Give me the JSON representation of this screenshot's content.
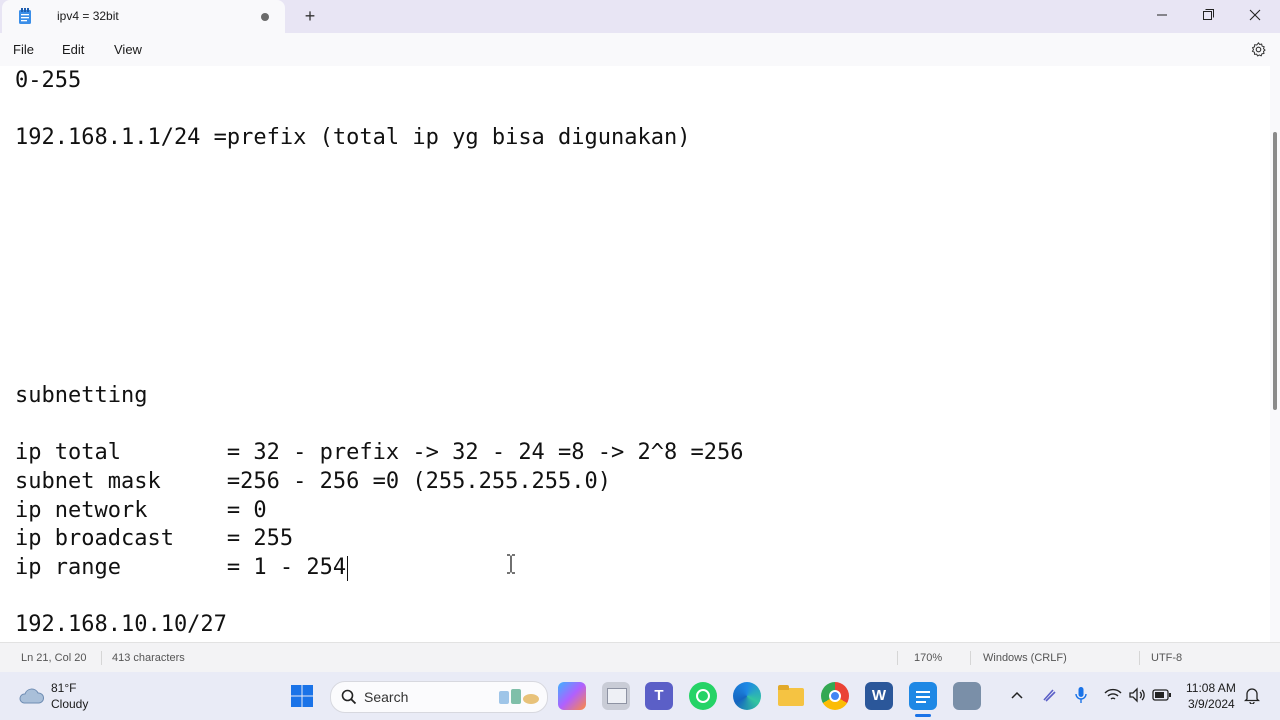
{
  "window": {
    "tab_title": "ipv4 = 32bit",
    "new_tab_symbol": "+"
  },
  "menu": {
    "file": "File",
    "edit": "Edit",
    "view": "View"
  },
  "editor": {
    "lines": [
      "0-255",
      "192.168.1.1/24 =prefix (total ip yg bisa digunakan)",
      "subnetting",
      "ip total        = 32 - prefix -> 32 - 24 =8 -> 2^8 =256",
      "subnet mask     =256 - 256 =0 (255.255.255.0)",
      "ip network      = 0",
      "ip broadcast    = 255",
      "ip range        = 1 - 254",
      "192.168.10.10/27"
    ]
  },
  "status": {
    "position": "Ln 21, Col 20",
    "characters": "413 characters",
    "zoom": "170%",
    "line_ending": "Windows (CRLF)",
    "encoding": "UTF-8"
  },
  "taskbar": {
    "weather_temp": "81°F",
    "weather_desc": "Cloudy",
    "search_placeholder": "Search",
    "time": "11:08 AM",
    "date": "3/9/2024"
  },
  "icons": [
    "notepad-icon",
    "minimize-icon",
    "maximize-icon",
    "close-icon",
    "settings-gear-icon",
    "weather-cloud-icon",
    "windows-start-icon",
    "search-icon",
    "copilot-icon",
    "file-explorer-icon",
    "teams-icon",
    "whatsapp-icon",
    "edge-icon",
    "folder-icon",
    "chrome-icon",
    "word-icon",
    "network-tray-icon",
    "microphone-icon",
    "pen-icon",
    "wifi-icon",
    "volume-icon",
    "battery-icon",
    "notification-bell-icon"
  ],
  "colors": {
    "title_bar": "#e8e5f4",
    "taskbar": "#e9ebf6",
    "notepad_blue": "#1e88e5",
    "word_blue": "#2b579a",
    "whatsapp_green": "#25d366"
  }
}
